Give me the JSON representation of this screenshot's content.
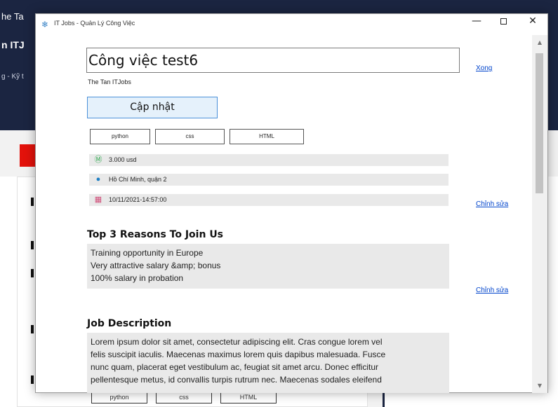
{
  "background": {
    "header_line1": "he Ta",
    "header_line2": "n ITJ",
    "header_line3": "g - Kỹ t",
    "tags": [
      "python",
      "css",
      "HTML"
    ]
  },
  "window": {
    "title": "IT Jobs - Quản Lý Công Việc",
    "minimize": "—",
    "close": "✕"
  },
  "job": {
    "title": "Công việc test6",
    "done_link": "Xong",
    "company": "The Tan ITJobs",
    "update_button": "Cập nhật",
    "tags": [
      "python",
      "css",
      "HTML"
    ],
    "salary": "3.000 usd",
    "location": "Hồ Chí Minh, quận 2",
    "datetime": "10/11/2021-14:57:00",
    "edit_link_info": "Chỉnh sửa"
  },
  "reasons": {
    "heading": "Top 3 Reasons To Join Us",
    "items": [
      "Training opportunity in Europe",
      "Very attractive salary &amp; bonus",
      "100% salary in probation"
    ],
    "edit_link": "Chỉnh sửa"
  },
  "description": {
    "heading": "Job Description",
    "lines": [
      "Lorem ipsum dolor sit amet, consectetur adipiscing elit. Cras congue lorem vel",
      "felis suscipit iaculis. Maecenas maximus lorem quis dapibus malesuada. Fusce",
      "nunc quam, placerat eget vestibulum ac, feugiat sit amet arcu. Donec efficitur",
      "pellentesque metus, id convallis turpis rutrum nec. Maecenas sodales eleifend"
    ]
  },
  "icons": {
    "salary": "dollar-coin-icon",
    "location": "person-pin-icon",
    "datetime": "calendar-icon"
  },
  "colors": {
    "link": "#0044cc",
    "button_bg": "#e5f1fb",
    "button_border": "#4a90d9",
    "header_bg": "#1b2541"
  }
}
